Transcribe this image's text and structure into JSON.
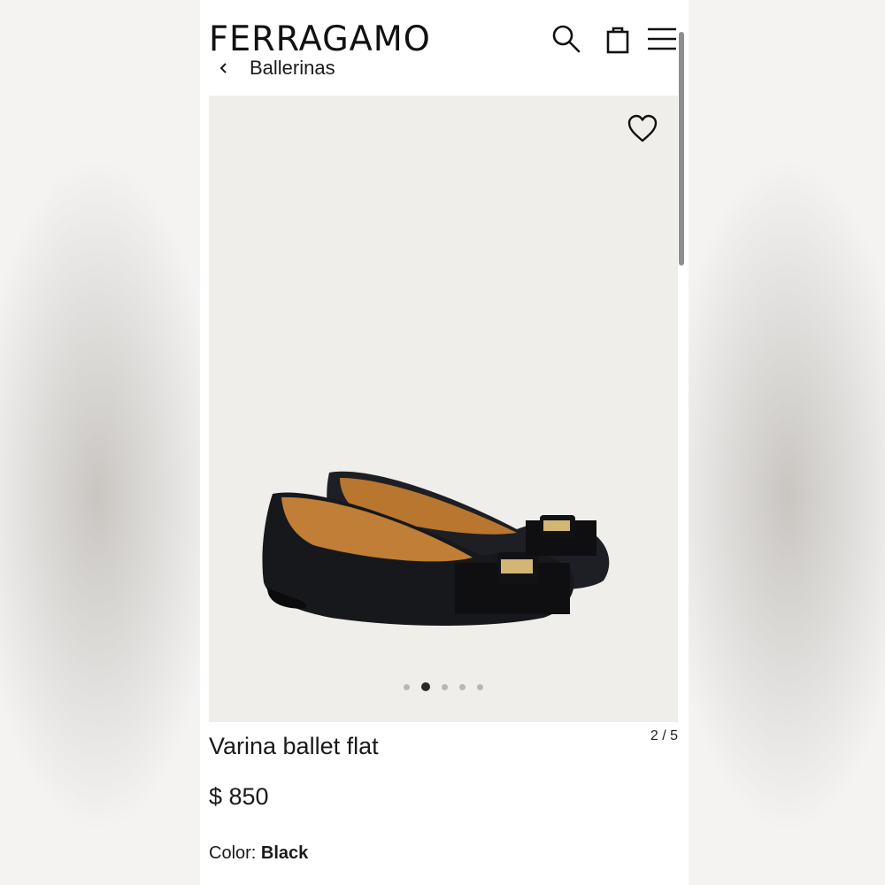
{
  "header": {
    "brand": "FERRAGAMO",
    "icons": [
      "search-icon",
      "bag-icon",
      "menu-icon"
    ]
  },
  "breadcrumb": {
    "back_icon": "chevron-left-icon",
    "label": "Ballerinas"
  },
  "gallery": {
    "wishlist_icon": "heart-icon",
    "total_images": 5,
    "active_index": 2,
    "counter": "2 / 5"
  },
  "product": {
    "name": "Varina ballet flat",
    "price": "$ 850",
    "color_label": "Color:",
    "color_value": "Black"
  },
  "colors": {
    "text": "#1a1a1a",
    "gallery_bg": "#efeeeb",
    "dot_active": "#2a2a2a",
    "dot_inactive": "#b9b7b3"
  }
}
